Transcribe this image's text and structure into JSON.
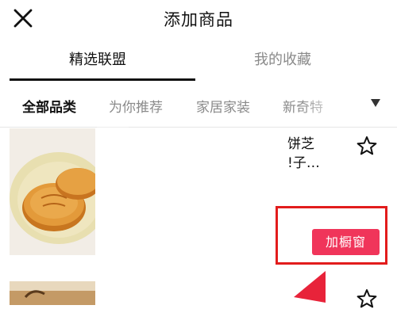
{
  "header": {
    "title": "添加商品",
    "close_icon": "close-icon"
  },
  "tabs": [
    {
      "label": "精选联盟",
      "active": true
    },
    {
      "label": "我的收藏",
      "active": false
    }
  ],
  "categories": [
    {
      "label": "全部品类",
      "active": true
    },
    {
      "label": "为你推荐",
      "active": false
    },
    {
      "label": "家居家装",
      "active": false
    },
    {
      "label": "新奇特",
      "active": false
    }
  ],
  "products": [
    {
      "title_line1": "饼芝",
      "title_line2": "!子…",
      "favorite_icon": "star-icon",
      "add_label": "加橱窗"
    },
    {
      "favorite_icon": "star-icon"
    }
  ],
  "colors": {
    "accent": "#f0355a",
    "highlight": "#e21c1c",
    "text": "#111111",
    "muted": "#8a8a8a"
  }
}
